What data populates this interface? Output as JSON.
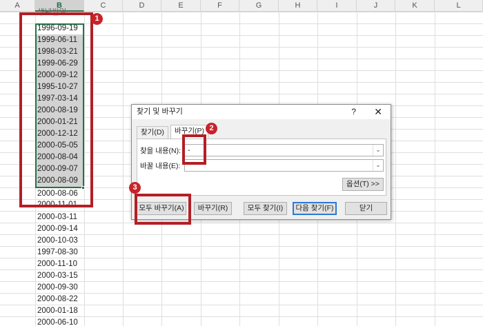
{
  "columns": [
    "A",
    "B",
    "C",
    "D",
    "E",
    "F",
    "G",
    "H",
    "I",
    "J",
    "K",
    "L"
  ],
  "column_b": {
    "header_partial": "생년월일",
    "cells": [
      "1996-09-19",
      "1999-06-11",
      "1998-03-21",
      "1999-06-29",
      "2000-09-12",
      "1995-10-27",
      "1997-03-14",
      "2000-08-19",
      "2000-01-21",
      "2000-12-12",
      "2000-05-05",
      "2000-08-04",
      "2000-09-07",
      "2000-08-09",
      "2000-08-06",
      "2000-11-01",
      "2000-03-11",
      "2000-09-14",
      "2000-10-03",
      "1997-08-30",
      "2000-11-10",
      "2000-03-15",
      "2000-09-30",
      "2000-08-22",
      "2000-01-18",
      "2000-06-10"
    ]
  },
  "badges": [
    "1",
    "2",
    "3"
  ],
  "dialog": {
    "title": "찾기 및 바꾸기",
    "help": "?",
    "close": "✕",
    "tabs": {
      "find": "찾기(D)",
      "replace": "바꾸기(P)"
    },
    "find_label": "찾을 내용(N):",
    "find_value": "-",
    "replace_label": "바꿀 내용(E):",
    "replace_value": "",
    "options_button": "옵션(T) >>",
    "buttons": {
      "replace_all": "모두 바꾸기(A)",
      "replace": "바꾸기(R)",
      "find_all": "모두 찾기(I)",
      "find_next": "다음 찾기(F)",
      "close": "닫기"
    }
  },
  "colors": {
    "annotation_red": "#b21f25",
    "selection_green": "#217346",
    "selection_fill": "#d2d2d2"
  }
}
